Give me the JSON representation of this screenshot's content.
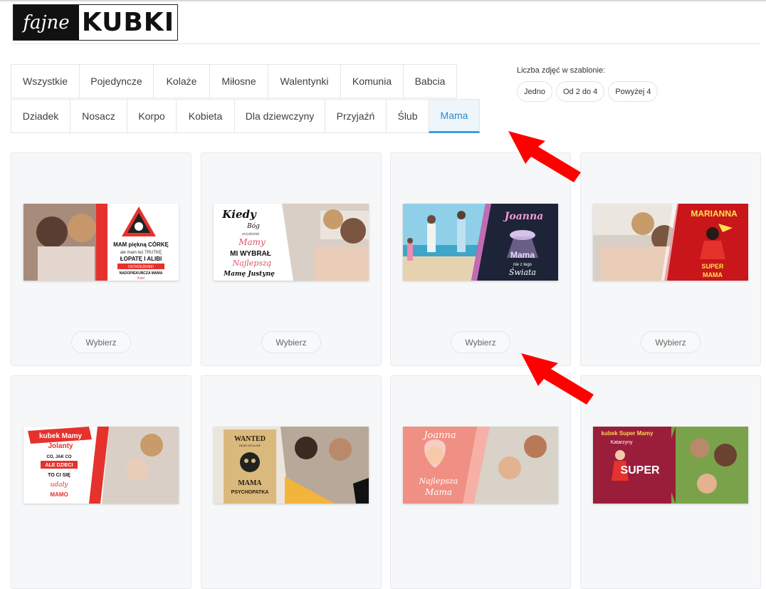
{
  "logo": {
    "left_text": "fajne",
    "right_text": "KUBKI"
  },
  "tabs_row1": [
    "Wszystkie",
    "Pojedyncze",
    "Kolaże",
    "Miłosne",
    "Walentynki",
    "Komunia",
    "Babcia"
  ],
  "tabs_row2": [
    "Dziadek",
    "Nosacz",
    "Korpo",
    "Kobieta",
    "Dla dziewczyny",
    "Przyjaźń",
    "Ślub",
    "Mama"
  ],
  "active_tab": "Mama",
  "photo_filter": {
    "label": "Liczba zdjęć w szablonie:",
    "options": [
      "Jedno",
      "Od 2 do 4",
      "Powyżej 4"
    ]
  },
  "card_button_label": "Wybierz",
  "templates": [
    {
      "lines": [
        "MAM piękną CÓRKĘ",
        "ale mam też TRUTKĘ",
        "ŁOPATĘ I ALIBI",
        "OSTRZEŻENIE!",
        "NADOPIEKUŃCZA MAMA",
        "Kasi"
      ]
    },
    {
      "lines": [
        "Kiedy",
        "Bóg",
        "przydzielał",
        "Mamy",
        "MI WYBRAŁ",
        "Najlepszą",
        "Mamę Justynę"
      ]
    },
    {
      "lines": [
        "Joanna",
        "Mama",
        "nie z tego",
        "Świata"
      ]
    },
    {
      "lines": [
        "MARIANNA",
        "SUPER",
        "MAMA"
      ]
    },
    {
      "lines": [
        "kubek Mamy",
        "Jolanty",
        "CO, JAK CO",
        "ALE DZIECI",
        "TO CI SIĘ",
        "udały",
        "MAMO"
      ]
    },
    {
      "lines": [
        "WANTED",
        "DEAD OR ALIVE",
        "MAMA",
        "PSYCHOPATKA"
      ]
    },
    {
      "lines": [
        "Joanna",
        "Najlepsza",
        "Mama"
      ]
    },
    {
      "lines": [
        "kubek Super Mamy",
        "Katarzyny",
        "SUPER"
      ]
    }
  ]
}
